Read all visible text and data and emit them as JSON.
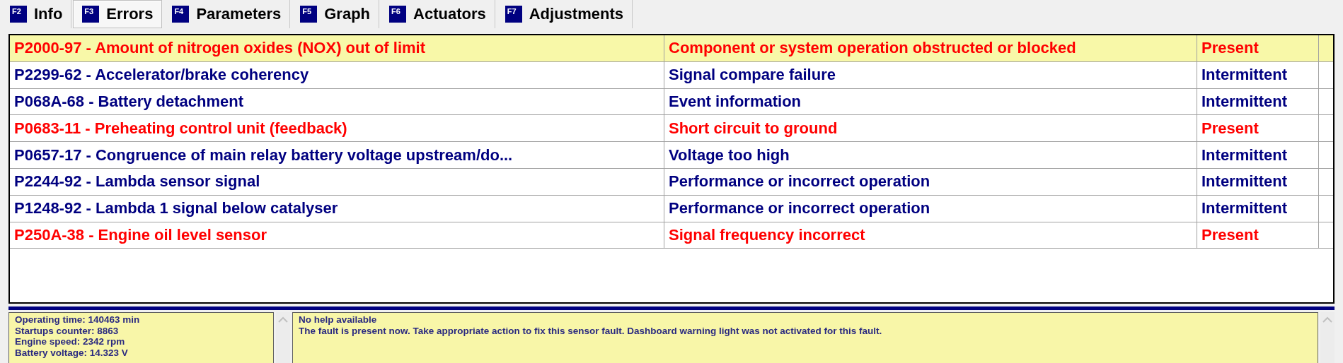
{
  "tabs": [
    {
      "key": "F2",
      "label": "Info",
      "selected": false
    },
    {
      "key": "F3",
      "label": "Errors",
      "selected": true
    },
    {
      "key": "F4",
      "label": "Parameters",
      "selected": false
    },
    {
      "key": "F5",
      "label": "Graph",
      "selected": false
    },
    {
      "key": "F6",
      "label": "Actuators",
      "selected": false
    },
    {
      "key": "F7",
      "label": "Adjustments",
      "selected": false
    }
  ],
  "faults": [
    {
      "code": "P2000-97 - Amount of nitrogen oxides (NOX) out of limit",
      "description": "Component or system operation obstructed or blocked",
      "status": "Present",
      "kind": "present",
      "selected": true
    },
    {
      "code": "P2299-62 - Accelerator/brake coherency",
      "description": "Signal compare failure",
      "status": "Intermittent",
      "kind": "intermittent",
      "selected": false
    },
    {
      "code": "P068A-68 - Battery detachment",
      "description": "Event information",
      "status": "Intermittent",
      "kind": "intermittent",
      "selected": false
    },
    {
      "code": "P0683-11 - Preheating control unit (feedback)",
      "description": "Short circuit to ground",
      "status": "Present",
      "kind": "present",
      "selected": false
    },
    {
      "code": "P0657-17 - Congruence of main relay battery voltage upstream/do...",
      "description": "Voltage too high",
      "status": "Intermittent",
      "kind": "intermittent",
      "selected": false
    },
    {
      "code": "P2244-92 - Lambda sensor signal",
      "description": "Performance or incorrect operation",
      "status": "Intermittent",
      "kind": "intermittent",
      "selected": false
    },
    {
      "code": "P1248-92 - Lambda 1 signal below catalyser",
      "description": "Performance or incorrect operation",
      "status": "Intermittent",
      "kind": "intermittent",
      "selected": false
    },
    {
      "code": "P250A-38 - Engine oil level sensor",
      "description": "Signal frequency incorrect",
      "status": "Present",
      "kind": "present",
      "selected": false
    }
  ],
  "freeze_frame": [
    "Operating time: 140463 min",
    "Startups counter: 8863",
    "Engine speed: 2342 rpm",
    "Battery voltage: 14.323 V"
  ],
  "help": {
    "title": "No help available",
    "text": "The fault is present now. Take appropriate action to fix this sensor fault. Dashboard warning light was not activated for this fault."
  }
}
